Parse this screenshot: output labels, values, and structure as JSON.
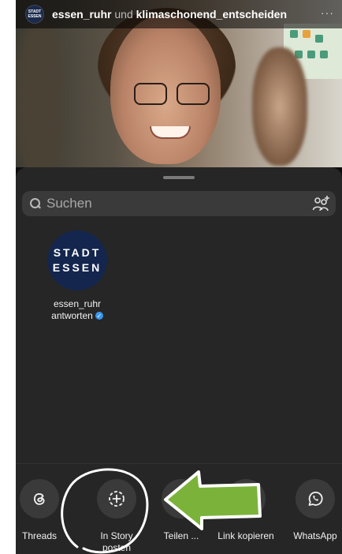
{
  "topbar": {
    "avatar_text": "STADT ESSEN",
    "account1": "essen_ruhr",
    "conjunction": "und",
    "account2": "klimaschonend_entscheiden",
    "more": "···"
  },
  "search": {
    "placeholder": "Suchen"
  },
  "contact": {
    "avatar_line1": "STADT",
    "avatar_line2": "ESSEN",
    "name": "essen_ruhr",
    "action": "antworten"
  },
  "actions": [
    {
      "label": "Threads"
    },
    {
      "label_line1": "In Story",
      "label_line2": "posten"
    },
    {
      "label": "Teilen ..."
    },
    {
      "label": "Link kopieren"
    },
    {
      "label": "WhatsApp"
    }
  ],
  "colors": {
    "sheet": "#262626",
    "annotation_arrow": "#7bb33a",
    "verified": "#3897f0"
  },
  "icons": [
    "search-icon",
    "add-people-icon",
    "threads-icon",
    "add-to-story-icon",
    "share-icon",
    "link-icon",
    "whatsapp-icon",
    "verified-icon"
  ]
}
